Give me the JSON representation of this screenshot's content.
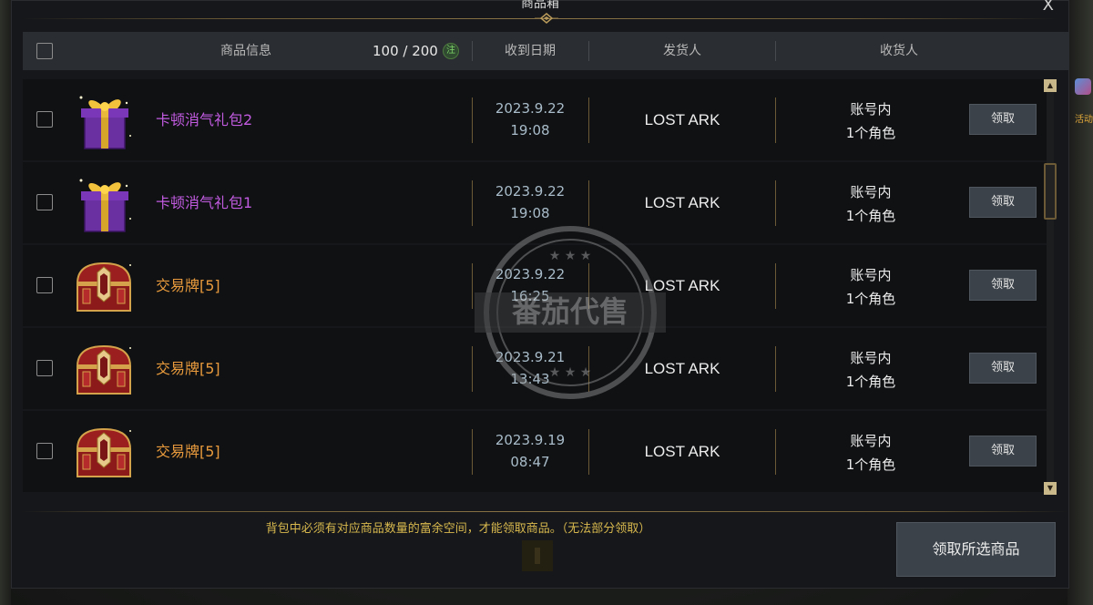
{
  "window": {
    "title": "商品箱",
    "close_label": "X"
  },
  "header": {
    "item_info": "商品信息",
    "count": "100 / 200",
    "note_badge": "注",
    "received_date": "收到日期",
    "sender": "发货人",
    "recipient": "收货人"
  },
  "rows": [
    {
      "name": "卡顿消气礼包2",
      "name_color": "#c25be0",
      "icon": "gift-box-icon",
      "date": "2023.9.22",
      "time": "19:08",
      "sender": "LOST ARK",
      "recv_line1": "账号内",
      "recv_line2": "1个角色",
      "claim": "领取"
    },
    {
      "name": "卡顿消气礼包1",
      "name_color": "#c25be0",
      "icon": "gift-box-icon",
      "date": "2023.9.22",
      "time": "19:08",
      "sender": "LOST ARK",
      "recv_line1": "账号内",
      "recv_line2": "1个角色",
      "claim": "领取"
    },
    {
      "name": "交易牌[5]",
      "name_color": "#e89a3c",
      "icon": "treasure-chest-icon",
      "date": "2023.9.22",
      "time": "16:25",
      "sender": "LOST ARK",
      "recv_line1": "账号内",
      "recv_line2": "1个角色",
      "claim": "领取"
    },
    {
      "name": "交易牌[5]",
      "name_color": "#e89a3c",
      "icon": "treasure-chest-icon",
      "date": "2023.9.21",
      "time": "13:43",
      "sender": "LOST ARK",
      "recv_line1": "账号内",
      "recv_line2": "1个角色",
      "claim": "领取"
    },
    {
      "name": "交易牌[5]",
      "name_color": "#e89a3c",
      "icon": "treasure-chest-icon",
      "date": "2023.9.19",
      "time": "08:47",
      "sender": "LOST ARK",
      "recv_line1": "账号内",
      "recv_line2": "1个角色",
      "claim": "领取"
    }
  ],
  "footer": {
    "notice": "背包中必须有对应商品数量的富余空间，才能领取商品。（无法部分领取）",
    "claim_all": "领取所选商品"
  },
  "side": {
    "label": "活动"
  },
  "watermark": {
    "text": "番茄代售"
  },
  "colors": {
    "accent_gold": "#8a7446",
    "notice_yellow": "#d8b84e",
    "epic_purple": "#c25be0",
    "legend_orange": "#e89a3c"
  }
}
